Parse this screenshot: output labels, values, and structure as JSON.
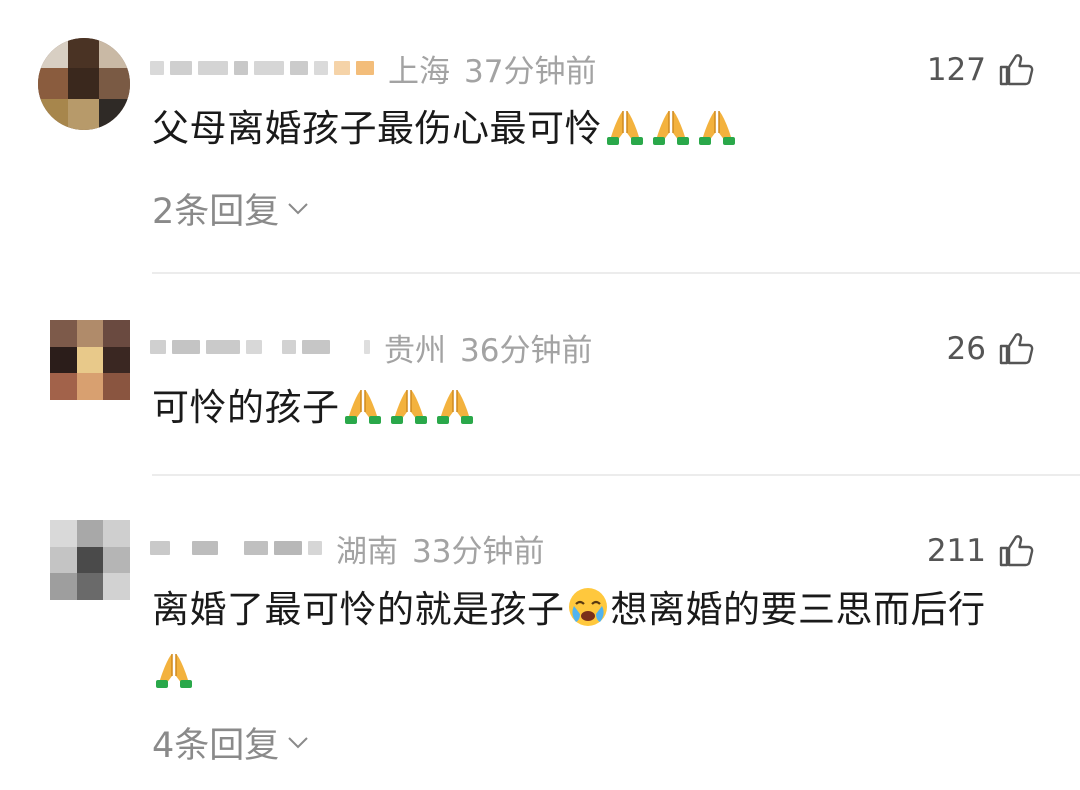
{
  "comments": [
    {
      "location": "上海",
      "time": "37分钟前",
      "likes": "127",
      "text": "父母离婚孩子最伤心最可怜",
      "emojis": [
        "praying-hands",
        "praying-hands",
        "praying-hands"
      ],
      "replies": "2条回复"
    },
    {
      "location": "贵州",
      "time": "36分钟前",
      "likes": "26",
      "text": "可怜的孩子",
      "emojis": [
        "praying-hands",
        "praying-hands",
        "praying-hands"
      ]
    },
    {
      "location": "湖南",
      "time": "33分钟前",
      "likes": "211",
      "text_part1": "离婚了最可怜的就是孩子",
      "text_part2": "想离婚的要三思而后行",
      "emojis": [
        "crying-face",
        "praying-hands"
      ],
      "replies": "4条回复"
    }
  ],
  "colors": {
    "meta_gray": "#a3a3a3",
    "text": "#1a1a1a",
    "divider": "#ececec"
  }
}
